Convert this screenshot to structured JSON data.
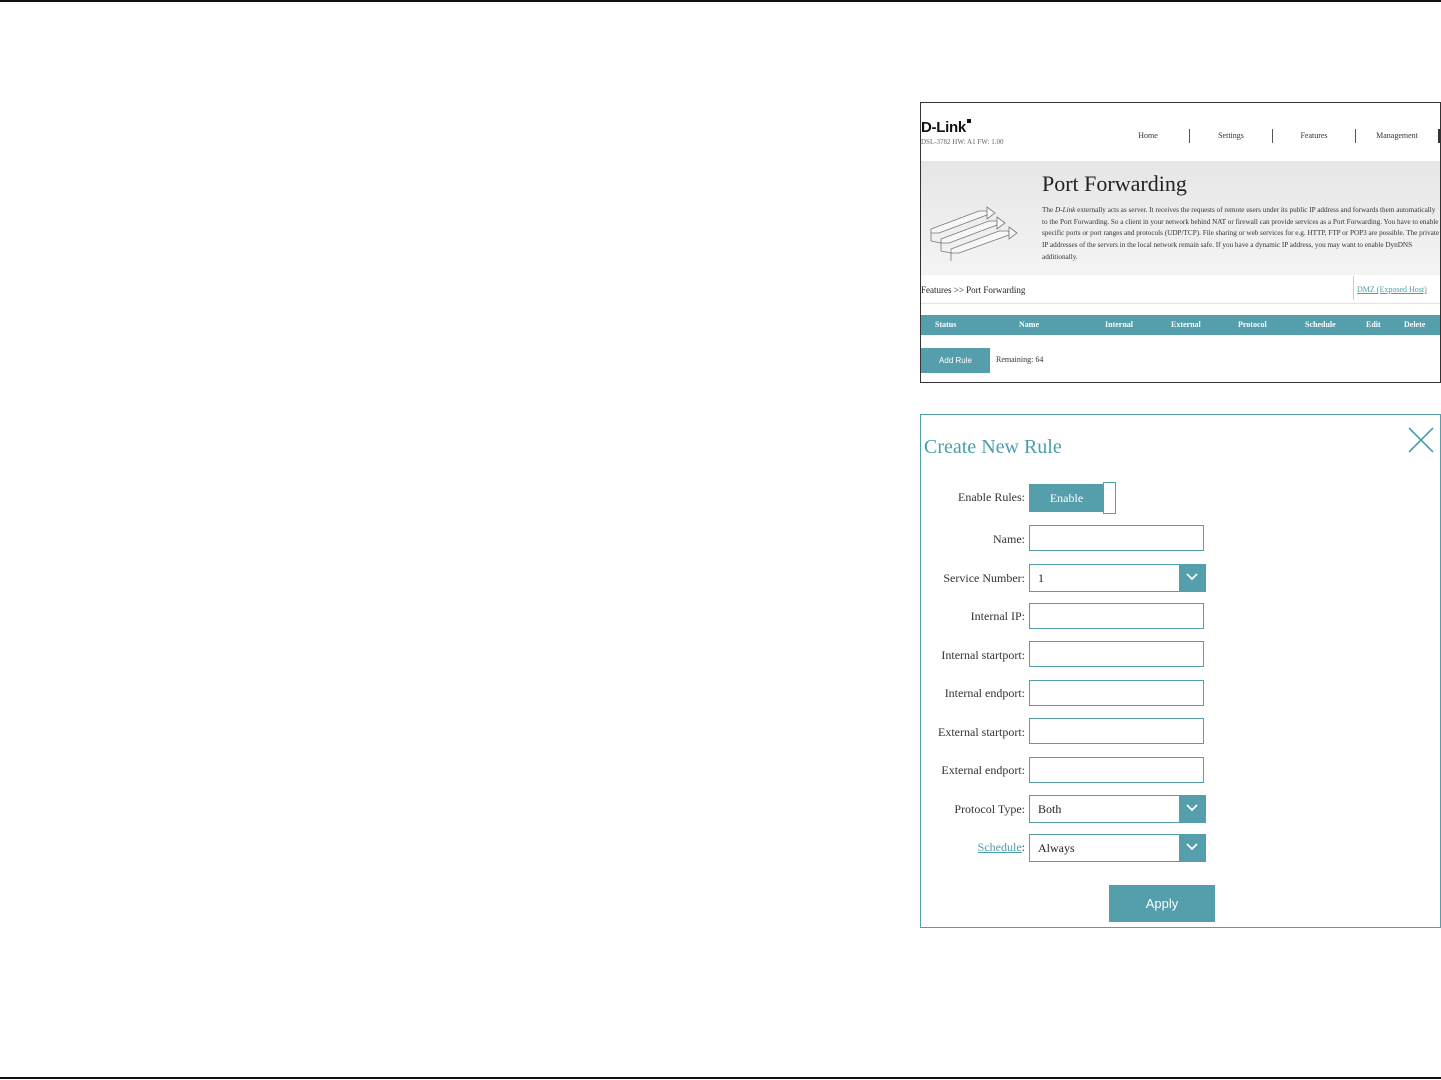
{
  "port_forwarding": {
    "logo": "D-Link",
    "model_info": "DSL-3782  HW: A1  FW: 1.00",
    "nav": [
      "Home",
      "Settings",
      "Features",
      "Management"
    ],
    "title": "Port Forwarding",
    "description_brand": "D-Link",
    "description_prefix": "The ",
    "description_rest": " externally acts as server. It receives the requests of remote users under its public IP address and forwards them automatically to the Port Forwarding. So a client in your network behind NAT or firewall can provide services as a Port Forwarding. You have to enable specific ports or port ranges and protocols (UDP/TCP). File sharing or web services for e.g. HTTP, FTP or POP3 are possible. The private IP addresses of the servers in the local network remain safe. If you have a dynamic IP address, you may want to enable DynDNS additionally.",
    "breadcrumb": "Features >> Port Forwarding",
    "dmz_link": "DMZ (Exposed Host)",
    "table_headers": [
      "Status",
      "Name",
      "Internal",
      "External",
      "Protocol",
      "Schedule",
      "Edit",
      "Delete"
    ],
    "add_rule_label": "Add Rule",
    "remaining": "Remaining: 64"
  },
  "create_rule": {
    "title": "Create New Rule",
    "enable_rules_label": "Enable Rules:",
    "enable_toggle_label": "Enable",
    "name_label": "Name:",
    "name_value": "",
    "service_number_label": "Service Number:",
    "service_number_value": "1",
    "internal_ip_label": "Internal IP:",
    "internal_startport_label": "Internal startport:",
    "internal_endport_label": "Internal endport:",
    "external_startport_label": "External startport:",
    "external_endport_label": "External endport:",
    "protocol_type_label": "Protocol Type:",
    "protocol_type_value": "Both",
    "schedule_link": "Schedule",
    "schedule_colon": ":",
    "schedule_value": "Always",
    "apply_label": "Apply"
  },
  "colors": {
    "accent": "#559eab",
    "link": "#4a9eaa"
  }
}
